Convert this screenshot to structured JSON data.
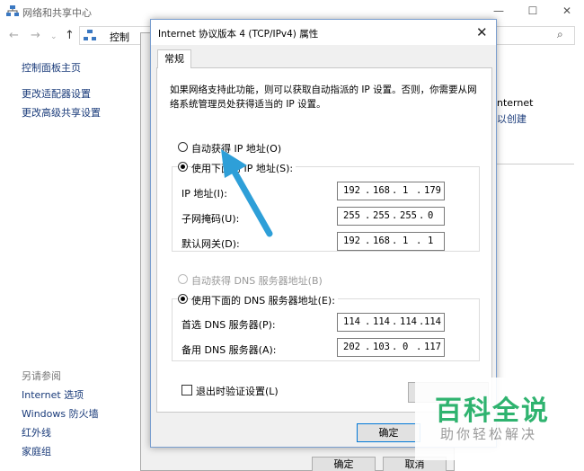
{
  "background_window": {
    "title": "网络和共享中心",
    "address_text": "控制",
    "left_nav": [
      "控制面板主页",
      "更改适配器设置",
      "更改高级共享设置"
    ],
    "see_also_heading": "另请参阅",
    "see_also": [
      "Internet 选项",
      "Windows 防火墙",
      "红外线",
      "家庭组"
    ],
    "right_texts": [
      "nternet",
      "以创建"
    ],
    "buttons": {
      "ok": "确定",
      "cancel": "取消"
    }
  },
  "dialog": {
    "title": "Internet 协议版本 4 (TCP/IPv4) 属性",
    "tab": "常规",
    "description": "如果网络支持此功能，则可以获取自动指派的 IP 设置。否则，你需要从网络系统管理员处获得适当的 IP 设置。",
    "ip_auto_label": "自动获得 IP 地址(O)",
    "ip_manual_label": "使用下面的 IP 地址(S):",
    "ip_fields": [
      {
        "label": "IP 地址(I):",
        "octets": [
          "192",
          "168",
          "1",
          "179"
        ]
      },
      {
        "label": "子网掩码(U):",
        "octets": [
          "255",
          "255",
          "255",
          "0"
        ]
      },
      {
        "label": "默认网关(D):",
        "octets": [
          "192",
          "168",
          "1",
          "1"
        ]
      }
    ],
    "dns_auto_label": "自动获得 DNS 服务器地址(B)",
    "dns_manual_label": "使用下面的 DNS 服务器地址(E):",
    "dns_fields": [
      {
        "label": "首选 DNS 服务器(P):",
        "octets": [
          "114",
          "114",
          "114",
          "114"
        ]
      },
      {
        "label": "备用 DNS 服务器(A):",
        "octets": [
          "202",
          "103",
          "0",
          "117"
        ]
      }
    ],
    "validate_label": "退出时验证设置(L)",
    "ok_label": "确定"
  },
  "watermark": {
    "big": "百科全说",
    "small": "助你轻松解决"
  },
  "colors": {
    "arrow": "#2e9fd8",
    "watermark_green": "#2fb36f",
    "link": "#1a3b7a"
  }
}
